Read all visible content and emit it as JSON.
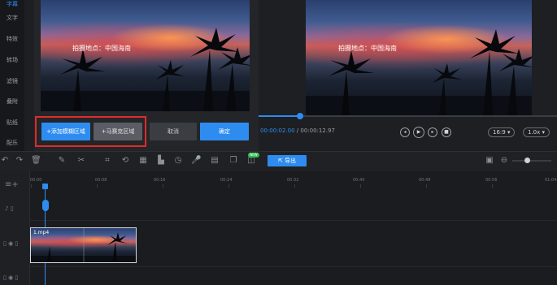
{
  "sidebar": {
    "items": [
      {
        "label": "字幕"
      },
      {
        "label": "文字"
      },
      {
        "label": "特效"
      },
      {
        "label": "转场"
      },
      {
        "label": "滤镜"
      },
      {
        "label": "叠附"
      },
      {
        "label": "贴纸"
      },
      {
        "label": "配乐"
      }
    ]
  },
  "editor": {
    "overlay_text": "拍摄地点：中国海南",
    "buttons": {
      "add_blur": "+添加模糊区域",
      "add_mosaic": "+马赛克区域",
      "cancel": "取消",
      "confirm": "确定"
    }
  },
  "player": {
    "overlay_text": "拍摄地点：中国海南",
    "time_current": "00:00:02.00",
    "time_separator": " / ",
    "time_total": "00:00:12.97",
    "progress": 0.14,
    "aspect_ratio": "16:9",
    "speed": "1.0x"
  },
  "toolbar": {
    "export_label": "导出",
    "new_badge": "NEW"
  },
  "timeline": {
    "ruler": [
      "00:00",
      "00:08",
      "00:16",
      "00:24",
      "00:32",
      "00:40",
      "00:48",
      "00:56",
      "01:04"
    ],
    "clip_label": "1.mp4"
  },
  "colors": {
    "accent": "#2e8cf0",
    "highlight_box": "#e02b2b",
    "background": "#1d1f23"
  }
}
